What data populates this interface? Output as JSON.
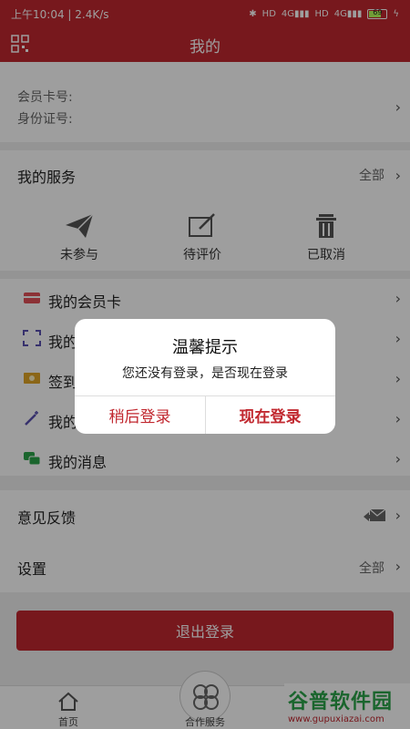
{
  "status_bar": {
    "time": "上午10:04 | 2.4K/s",
    "indicators": [
      "bluetooth-icon",
      "hd-icon",
      "4g-signal-icon",
      "hd-icon",
      "4g-signal-icon"
    ],
    "battery": "69",
    "charging_icon": "bolt-icon"
  },
  "header": {
    "title": "我的",
    "left_icon": "qr-code-icon"
  },
  "member": {
    "card_no_label": "会员卡号:",
    "id_no_label": "身份证号:"
  },
  "services": {
    "title": "我的服务",
    "all_label": "全部",
    "items": [
      {
        "label": "未参与",
        "icon": "paper-plane-icon"
      },
      {
        "label": "待评价",
        "icon": "edit-icon"
      },
      {
        "label": "已取消",
        "icon": "trash-icon"
      }
    ]
  },
  "list": {
    "items": [
      {
        "label": "我的会员卡",
        "icon": "card-icon"
      },
      {
        "label": "我的",
        "icon": "scan-icon"
      },
      {
        "label": "签到",
        "icon": "ticket-icon"
      },
      {
        "label": "我的",
        "icon": "magic-wand-icon"
      },
      {
        "label": "我的消息",
        "icon": "chat-icon"
      }
    ]
  },
  "misc": {
    "feedback_label": "意见反馈",
    "feedback_icon": "mail-reply-icon",
    "settings_label": "设置",
    "settings_all": "全部"
  },
  "logout_label": "退出登录",
  "bottom_nav": {
    "home_label": "首页",
    "partner_label": "合作服务"
  },
  "watermark": {
    "brand": "谷普软件园",
    "url": "www.gupuxiazai.com"
  },
  "dialog": {
    "title": "温馨提示",
    "message": "您还没有登录，是否现在登录",
    "cancel_label": "稍后登录",
    "confirm_label": "现在登录"
  },
  "colors": {
    "brand_red": "#c1282f",
    "overlay": "rgba(0,0,0,0.38)",
    "watermark_green": "#2aa34a"
  }
}
